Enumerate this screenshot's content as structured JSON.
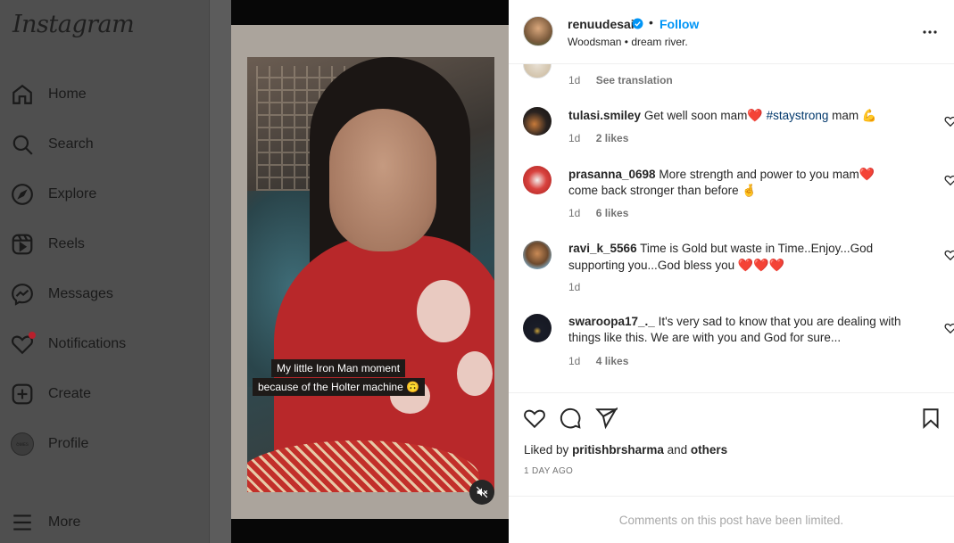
{
  "app": {
    "logo_text": "Instagram"
  },
  "sidebar": {
    "items": [
      {
        "label": "Home",
        "icon": "home-icon"
      },
      {
        "label": "Search",
        "icon": "search-icon"
      },
      {
        "label": "Explore",
        "icon": "compass-icon"
      },
      {
        "label": "Reels",
        "icon": "reels-icon"
      },
      {
        "label": "Messages",
        "icon": "messenger-icon"
      },
      {
        "label": "Notifications",
        "icon": "heart-icon"
      },
      {
        "label": "Create",
        "icon": "plus-square-icon"
      },
      {
        "label": "Profile",
        "icon": "avatar"
      },
      {
        "label": "More",
        "icon": "hamburger-icon"
      }
    ],
    "profile_avatar_text": "ꝺᴍᴇs"
  },
  "media": {
    "caption_line1": "My little Iron Man moment",
    "caption_line2": "because of the Holter machine",
    "caption_emoji": "🙃",
    "mute_icon": "speaker-muted-icon"
  },
  "post": {
    "username": "renuudesai",
    "dot": "•",
    "follow_label": "Follow",
    "location": "Woodsman • dream river."
  },
  "comments": [
    {
      "user": "",
      "text": "",
      "time": "1d",
      "extra": "See translation",
      "likes": ""
    },
    {
      "user": "tulasi.smiley",
      "text": "Get well soon mam",
      "heart_after": "❤️",
      "hashtag": "#staystrong",
      "text2": "mam",
      "emoji2": "💪",
      "time": "1d",
      "likes": "2 likes"
    },
    {
      "user": "prasanna_0698",
      "text": "More strength and power to you mam",
      "heart_after": "❤️",
      "text_line2": "come back stronger than before",
      "emoji2": "🤞",
      "time": "1d",
      "likes": "6 likes"
    },
    {
      "user": "ravi_k_5566",
      "text": "Time is Gold but waste in Time..Enjoy...God",
      "text_line2": "supporting you...God bless you",
      "emoji2": "❤️❤️❤️",
      "time": "1d",
      "likes": ""
    },
    {
      "user": "swaroopa17_._",
      "text": "It's very sad to know that you are dealing with",
      "text_line2": "things like this. We are with you and God for sure...",
      "time": "1d",
      "likes": "4 likes"
    }
  ],
  "actions": {
    "liked_by_prefix": "Liked by",
    "liked_by_user": "pritishbrsharma",
    "liked_by_and": "and",
    "liked_by_others": "others",
    "date": "1 DAY AGO"
  },
  "footer": {
    "limited_text": "Comments on this post have been limited."
  },
  "colors": {
    "follow": "#0095f6",
    "hashtag": "#00376b",
    "meta": "#737373",
    "heart": "#e0142e"
  }
}
